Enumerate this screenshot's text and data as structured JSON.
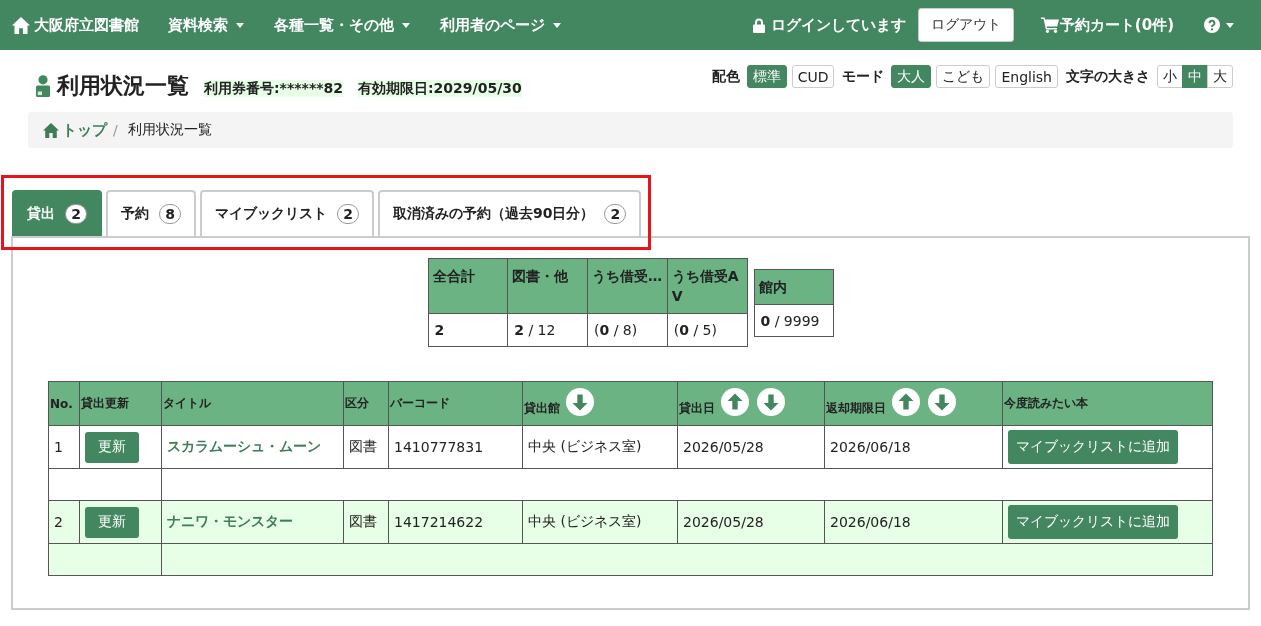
{
  "navbar": {
    "brand": "大阪府立図書館",
    "menus": [
      {
        "label": "資料検索"
      },
      {
        "label": "各種一覧・その他"
      },
      {
        "label": "利用者のページ"
      }
    ],
    "login_status": "ログインしています",
    "logout_button": "ログアウト",
    "cart": "予約カート(0件)"
  },
  "page_header": {
    "title": "利用状況一覧",
    "card_number": "利用券番号:******82",
    "expiry": "有効期限日:2029/05/30"
  },
  "display_settings": [
    {
      "label": "配色",
      "kind": "buttons",
      "options": [
        {
          "label": "標準",
          "selected": true
        },
        {
          "label": "CUD",
          "selected": false
        }
      ]
    },
    {
      "label": "モード",
      "kind": "buttons",
      "options": [
        {
          "label": "大人",
          "selected": true
        },
        {
          "label": "こども",
          "selected": false
        },
        {
          "label": "English",
          "selected": false
        }
      ]
    },
    {
      "label": "文字の大きさ",
      "kind": "segmented",
      "options": [
        {
          "label": "小",
          "selected": false
        },
        {
          "label": "中",
          "selected": true
        },
        {
          "label": "大",
          "selected": false
        }
      ]
    }
  ],
  "breadcrumb": {
    "separator": "/",
    "items": [
      {
        "label": "トップ",
        "kind": "home"
      },
      {
        "label": "利用状況一覧",
        "kind": "current"
      }
    ]
  },
  "tabs": {
    "highlighted": true,
    "items": [
      {
        "label": "貸出",
        "count": "2",
        "selected": true
      },
      {
        "label": "予約",
        "count": "8",
        "selected": false
      },
      {
        "label": "マイブックリスト",
        "count": "2",
        "selected": false
      },
      {
        "label": "取消済みの予約（過去90日分）",
        "count": "2",
        "selected": false
      }
    ]
  },
  "summary": {
    "columns": [
      {
        "label": "全合計",
        "value": "2",
        "kind": "total"
      },
      {
        "label": "図書・他",
        "value": "**2** / 12",
        "kind": "ratio"
      },
      {
        "label": "うち借受…",
        "value": "(**0** / 8)",
        "kind": "ratio"
      },
      {
        "label": "うち借受AV",
        "value": "(**0** / 5)",
        "kind": "ratio"
      }
    ]
  },
  "in_library": {
    "columns": [
      {
        "label": "館内",
        "value": "**0** / 9999",
        "kind": "ratio"
      }
    ]
  },
  "loans": {
    "columns": [
      {
        "label": "No.",
        "sort_up": false,
        "sort_down": false
      },
      {
        "label": "貸出更新",
        "sort_up": false,
        "sort_down": false
      },
      {
        "label": "タイトル",
        "sort_up": false,
        "sort_down": false
      },
      {
        "label": "区分",
        "sort_up": false,
        "sort_down": false
      },
      {
        "label": "バーコード",
        "sort_up": false,
        "sort_down": false
      },
      {
        "label": "貸出館",
        "sort_up": false,
        "sort_down": true
      },
      {
        "label": "貸出日",
        "sort_up": true,
        "sort_down": true
      },
      {
        "label": "返却期限日",
        "sort_up": true,
        "sort_down": true
      },
      {
        "label": "今度読みたい本",
        "sort_up": false,
        "sort_down": false
      }
    ],
    "rows": [
      {
        "no": "1",
        "renew_button": "更新",
        "title": "スカラムーシュ・ムーン",
        "category": "図書",
        "barcode": "1410777831",
        "library": "中央 (ビジネス室)",
        "loan_date": "2026/05/28",
        "due_date": "2026/06/18",
        "mybook_button": "マイブックリストに追加"
      },
      {
        "no": "2",
        "renew_button": "更新",
        "title": "ナニワ・モンスター",
        "category": "図書",
        "barcode": "1417214622",
        "library": "中央 (ビジネス室)",
        "loan_date": "2026/05/28",
        "due_date": "2026/06/18",
        "mybook_button": "マイブックリストに追加"
      }
    ]
  }
}
